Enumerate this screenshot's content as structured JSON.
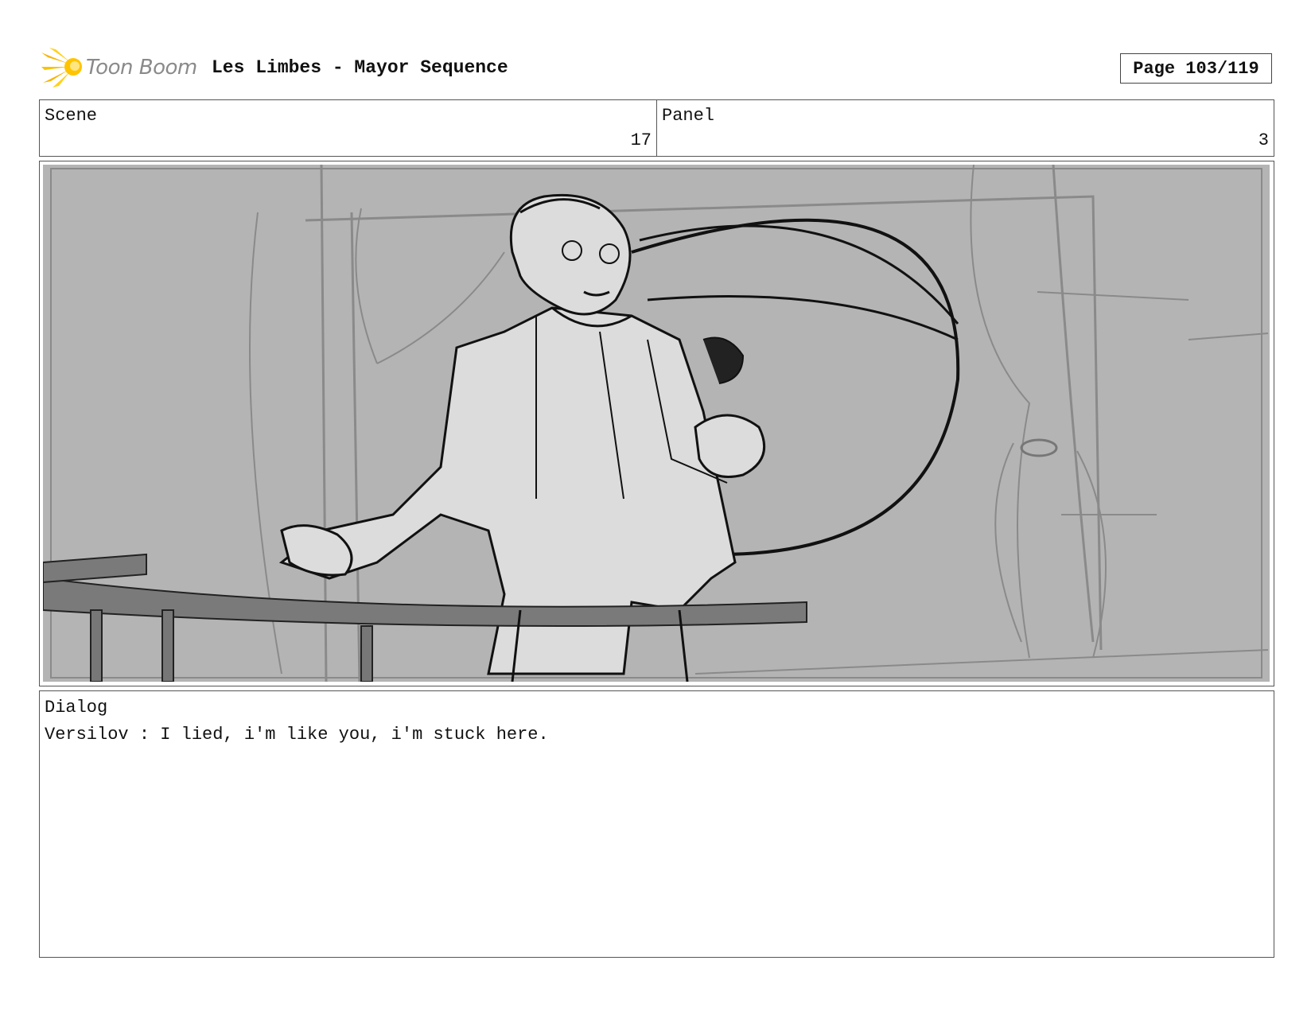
{
  "header": {
    "logo_text": "Toon Boom",
    "title": "Les Limbes - Mayor Sequence",
    "page": "Page 103/119"
  },
  "info": {
    "scene_label": "Scene",
    "scene_value": "17",
    "panel_label": "Panel",
    "panel_value": "3"
  },
  "panel": {
    "image_icon": "storyboard-sketch",
    "background_color": "#b4b4b4"
  },
  "dialog": {
    "label": "Dialog",
    "text": "Versilov : I lied, i'm like you, i'm stuck here."
  }
}
